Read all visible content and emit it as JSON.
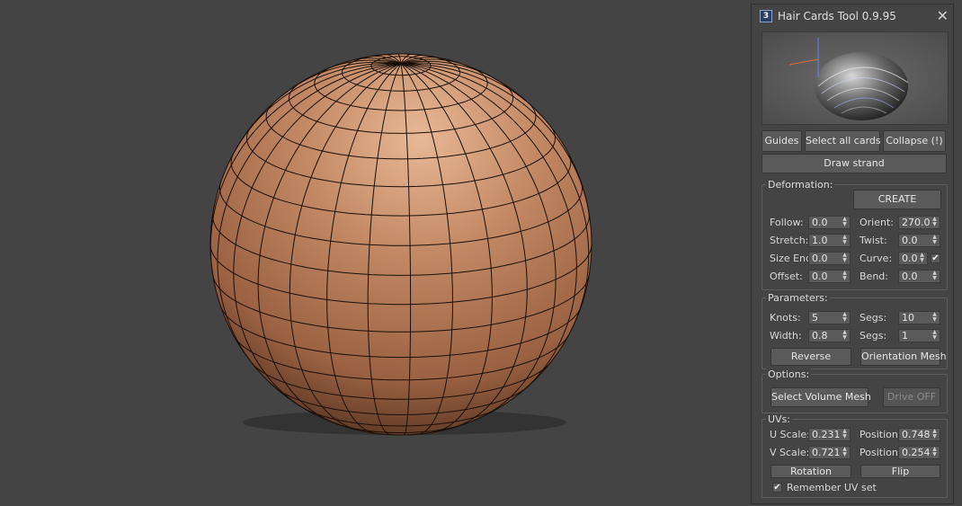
{
  "window": {
    "title": "Hair Cards Tool 0.9.95",
    "icon_text": "3",
    "close_glyph": "✕"
  },
  "toolbar": {
    "guides": "Guides",
    "select_all_cards": "Select all cards",
    "collapse": "Collapse (!)",
    "draw_strand": "Draw strand"
  },
  "deformation": {
    "title": "Deformation:",
    "create": "CREATE",
    "follow_label": "Follow:",
    "follow_value": "0.0",
    "orient_label": "Orient:",
    "orient_value": "270.0",
    "stretch_label": "Stretch:",
    "stretch_value": "1.0",
    "twist_label": "Twist:",
    "twist_value": "0.0",
    "size_end_label": "Size End",
    "size_end_value": "0.0",
    "curve_label": "Curve:",
    "curve_value": "0.0",
    "curve_checked": "✔",
    "offset_label": "Offset:",
    "offset_value": "0.0",
    "bend_label": "Bend:",
    "bend_value": "0.0"
  },
  "parameters": {
    "title": "Parameters:",
    "knots_label": "Knots:",
    "knots_value": "5",
    "segs1_label": "Segs:",
    "segs1_value": "10",
    "width_label": "Width:",
    "width_value": "0.8",
    "segs2_label": "Segs:",
    "segs2_value": "1",
    "reverse": "Reverse",
    "orientation_mesh": "Orientation Mesh"
  },
  "options": {
    "title": "Options:",
    "select_volume_mesh": "Select Volume Mesh",
    "drive_off": "Drive OFF"
  },
  "uvs": {
    "title": "UVs:",
    "u_scale_label": "U Scale:",
    "u_scale_value": "0.231",
    "u_position_label": "Position:",
    "u_position_value": "0.748",
    "v_scale_label": "V Scale:",
    "v_scale_value": "0.721",
    "v_position_label": "Position:",
    "v_position_value": "0.254",
    "rotation": "Rotation",
    "flip": "Flip",
    "remember_checked": "✔",
    "remember_label": "Remember UV set"
  },
  "spinner_arrows": "▲▼",
  "colors": {
    "viewport_bg": "#444444",
    "sphere_mid": "#b57a57",
    "panel_bg": "#444444"
  }
}
